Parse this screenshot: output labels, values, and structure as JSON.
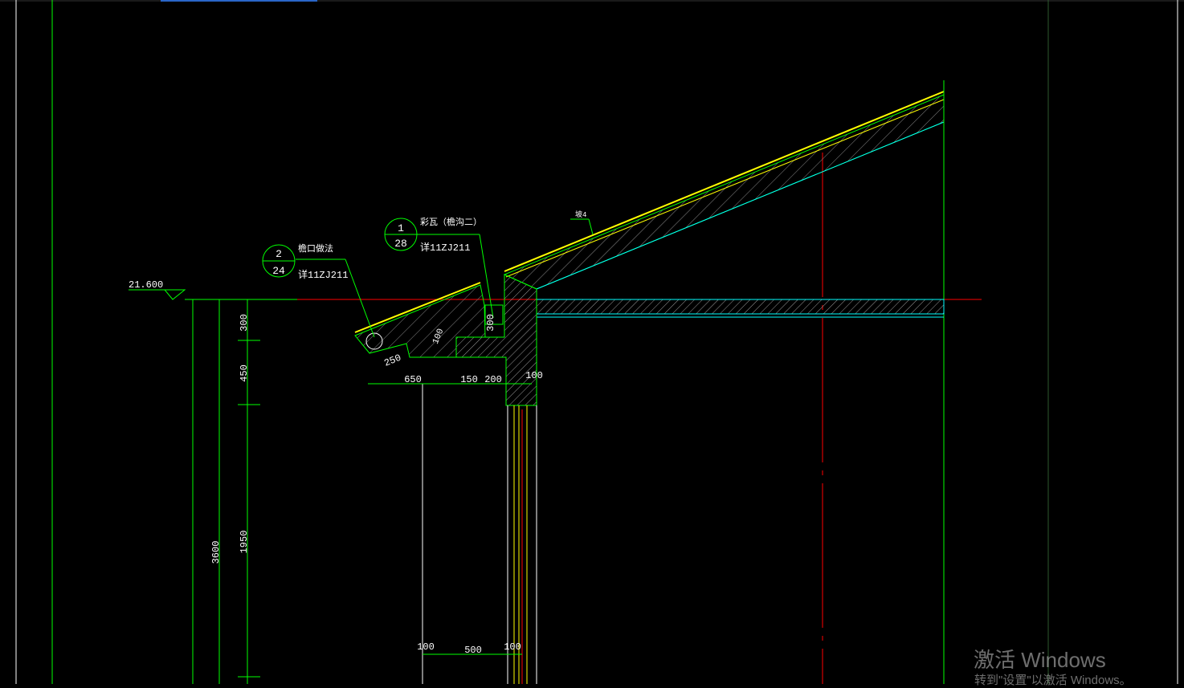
{
  "drawing": {
    "elevation_label": "21.600",
    "callout_1": {
      "number": "1",
      "sheet": "28",
      "title": "彩瓦（檐沟二）",
      "ref": "详11ZJ211"
    },
    "callout_2": {
      "number": "2",
      "sheet": "24",
      "title": "檐口做法",
      "ref": "详11ZJ211"
    },
    "slope_label": "坡4",
    "dims": {
      "d300a": "300",
      "d450": "450",
      "d1950": "1950",
      "d3600": "3600",
      "d250": "250",
      "d650": "650",
      "d150": "150",
      "d200": "200",
      "d100a": "100",
      "d300b": "300",
      "d100b": "100",
      "d500": "500",
      "d100c": "100",
      "d100d": "100"
    }
  },
  "colors": {
    "background": "#000000",
    "green": "#00ff00",
    "red": "#ff0000",
    "cyan": "#00ffff",
    "yellow": "#ffff00",
    "white": "#ffffff",
    "line_gray": "#9a9a9a"
  },
  "watermark": {
    "title": "激活 Windows",
    "subtitle": "转到\"设置\"以激活 Windows。"
  }
}
